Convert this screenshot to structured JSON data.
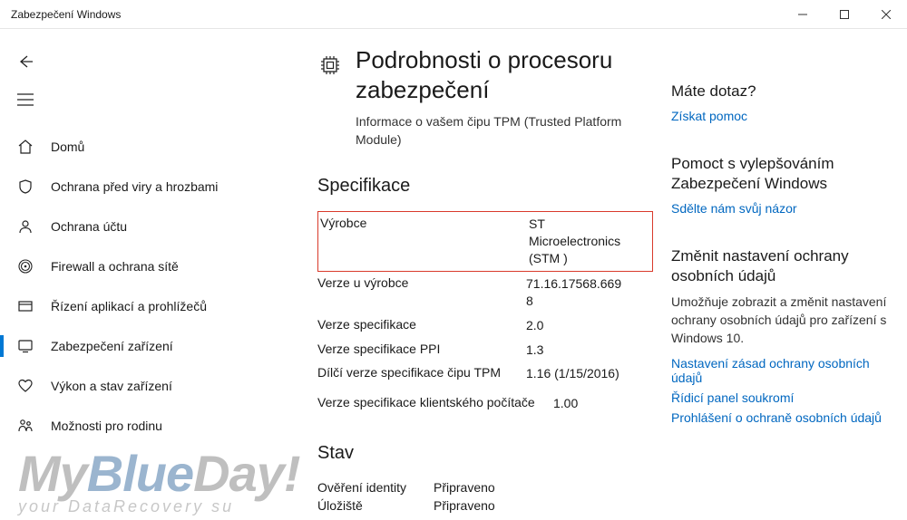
{
  "window": {
    "title": "Zabezpečení Windows"
  },
  "sidebar": {
    "items": [
      {
        "icon": "home",
        "label": "Domů"
      },
      {
        "icon": "shield",
        "label": "Ochrana před viry a hrozbami"
      },
      {
        "icon": "person",
        "label": "Ochrana účtu"
      },
      {
        "icon": "wifi",
        "label": "Firewall a ochrana sítě"
      },
      {
        "icon": "app",
        "label": "Řízení aplikací a prohlížečů"
      },
      {
        "icon": "device",
        "label": "Zabezpečení zařízení"
      },
      {
        "icon": "heart",
        "label": "Výkon a stav zařízení"
      },
      {
        "icon": "family",
        "label": "Možnosti pro rodinu"
      }
    ]
  },
  "page": {
    "title": "Podrobnosti o procesoru zabezpečení",
    "subtitle": "Informace o vašem čipu TPM (Trusted Platform Module)"
  },
  "spec": {
    "heading": "Specifikace",
    "rows": [
      {
        "label": "Výrobce",
        "value": "ST Microelectronics (STM )",
        "hl": true
      },
      {
        "label": "Verze u výrobce",
        "value": "71.16.17568.6698"
      },
      {
        "label": "Verze specifikace",
        "value": "2.0"
      },
      {
        "label": "Verze specifikace PPI",
        "value": "1.3"
      },
      {
        "label": "Dílčí verze specifikace čipu TPM",
        "value": "1.16 (1/15/2016)"
      },
      {
        "label": "Verze specifikace klientského počítače",
        "value": "1.00"
      }
    ]
  },
  "status": {
    "heading": "Stav",
    "rows": [
      {
        "label": "Ověření identity",
        "value": "Připraveno"
      },
      {
        "label": "Úložiště",
        "value": "Připraveno"
      }
    ]
  },
  "right": {
    "help_h": "Máte dotaz?",
    "help_link": "Získat pomoc",
    "feedback_h": "Pomoct s vylepšováním Zabezpečení Windows",
    "feedback_link": "Sdělte nám svůj názor",
    "privacy_h": "Změnit nastavení ochrany osobních údajů",
    "privacy_desc": "Umožňuje zobrazit a změnit nastavení ochrany osobních údajů pro zařízení s Windows 10.",
    "privacy_links": [
      "Nastavení zásad ochrany osobních údajů",
      "Řídicí panel soukromí",
      "Prohlášení o ochraně osobních údajů"
    ]
  },
  "watermark": {
    "line1a": "My",
    "line1b": "Blue",
    "line1c": "Day!",
    "tag": "your DataRecovery su"
  }
}
